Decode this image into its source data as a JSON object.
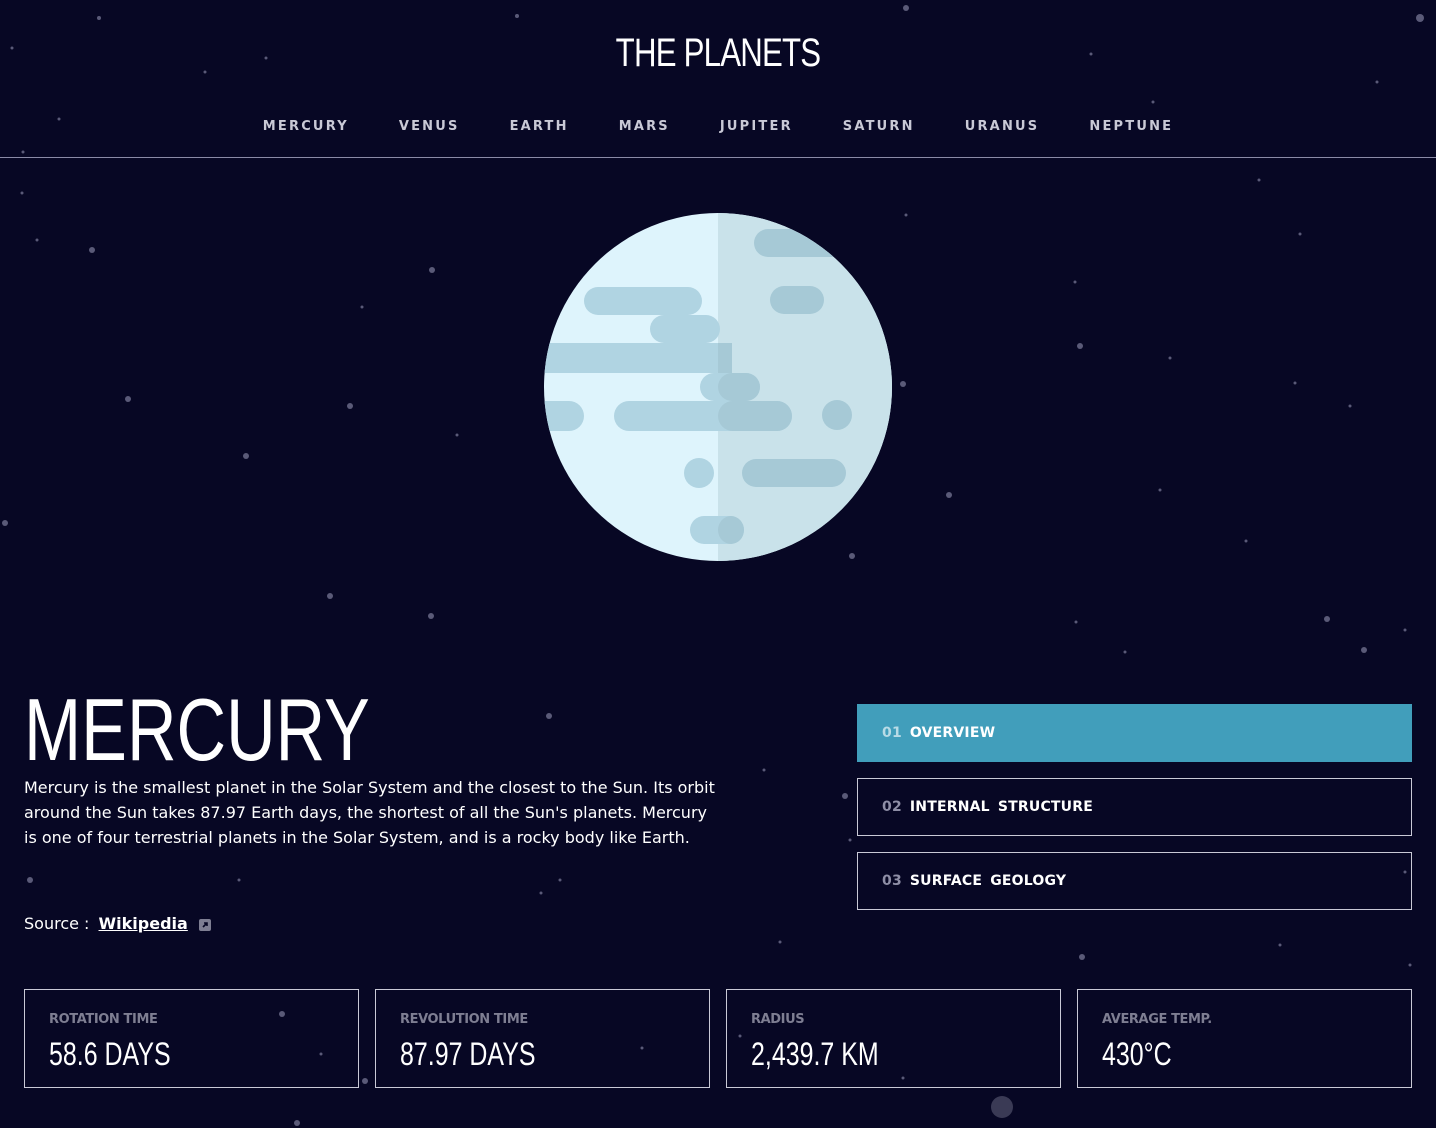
{
  "app": {
    "title": "THE PLANETS"
  },
  "nav": {
    "items": [
      {
        "label": "MERCURY"
      },
      {
        "label": "VENUS"
      },
      {
        "label": "EARTH"
      },
      {
        "label": "MARS"
      },
      {
        "label": "JUPITER"
      },
      {
        "label": "SATURN"
      },
      {
        "label": "URANUS"
      },
      {
        "label": "NEPTUNE"
      }
    ]
  },
  "planet": {
    "name": "MERCURY",
    "description": "Mercury is the smallest planet in the Solar System and the closest to the Sun. Its orbit around the Sun takes 87.97 Earth days, the shortest of all the Sun's planets. Mercury is one of four terrestrial planets in the Solar System, and is a rocky body like Earth.",
    "source_label": "Source :",
    "source_link": "Wikipedia",
    "image_icon": "mercury-planet-illustration"
  },
  "tabs": [
    {
      "num": "01",
      "label": "OVERVIEW",
      "active": true
    },
    {
      "num": "02",
      "label": "INTERNAL STRUCTURE",
      "active": false
    },
    {
      "num": "03",
      "label": "SURFACE GEOLOGY",
      "active": false
    }
  ],
  "stats": [
    {
      "label": "ROTATION TIME",
      "value": "58.6 DAYS"
    },
    {
      "label": "REVOLUTION TIME",
      "value": "87.97 DAYS"
    },
    {
      "label": "RADIUS",
      "value": "2,439.7 KM"
    },
    {
      "label": "AVERAGE TEMP.",
      "value": "430°C"
    }
  ],
  "colors": {
    "background": "#070724",
    "accent": "#419ebb",
    "border": "#c9c9d6",
    "muted": "#7e7e92",
    "planet_light": "#def4fc",
    "planet_shade": "#c9e2ea",
    "crater": "#b0d4e2"
  }
}
